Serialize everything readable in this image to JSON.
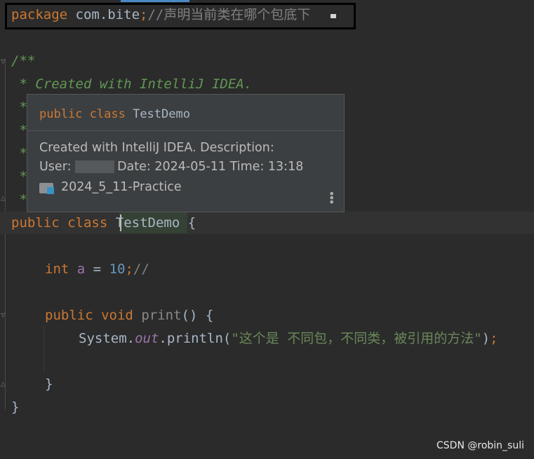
{
  "code": {
    "line1": {
      "kw": "package",
      "pkg": " com.bite",
      "semi": ";",
      "comment": "//声明当前类在哪个包底下"
    },
    "doc_open": "/**",
    "doc_line": " * Created with IntelliJ IDEA.",
    "doc_stars": [
      " *",
      " *",
      " *",
      " *",
      " *"
    ],
    "class_decl": {
      "kw1": "public",
      "kw2": "class",
      "name": "TestDemo",
      "brace": "{"
    },
    "field_decl": {
      "type": "int",
      "name": "a",
      "eq": " = ",
      "value": "10",
      "semi": ";",
      "comment": "//"
    },
    "method_decl": {
      "kw1": "public",
      "kw2": "void",
      "name": "print",
      "rest": "() {"
    },
    "println": {
      "sys": "System.",
      "static": "out",
      "call": ".println(",
      "string": "\"这个是 不同包，不同类，被引用的方法\"",
      "end": ")",
      "semi": ";"
    },
    "method_close": "}",
    "class_close": "}"
  },
  "popup": {
    "signature_kw": "public class",
    "signature_name": "TestDemo",
    "line1": "Created with IntelliJ IDEA. Description:",
    "user_label": "User:",
    "date_text": "Date: 2024-05-11 Time: 13:18",
    "project": "2024_5_11-Practice",
    "more_icon": "vertical-dots-icon"
  },
  "watermark": "CSDN @robin_suli",
  "colors": {
    "background": "#2b2b2b",
    "keyword": "#cc7832",
    "doc": "#629755",
    "string": "#6a8759",
    "number": "#6897bb",
    "field": "#9876aa"
  }
}
